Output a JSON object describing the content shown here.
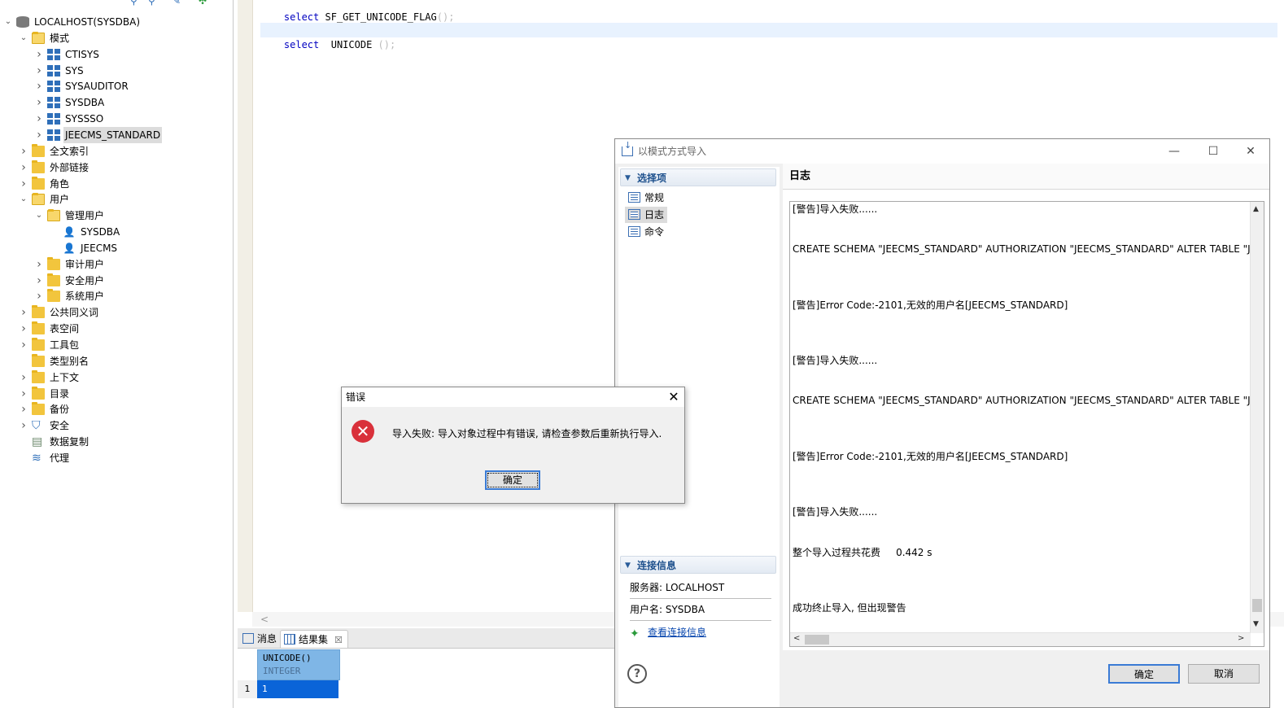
{
  "navigator": {
    "tree": [
      {
        "label": "LOCALHOST(SYSDBA)",
        "icon": "database-server-icon",
        "expanded": true,
        "indent": 0
      },
      {
        "label": "模式",
        "icon": "folder-open-icon",
        "expanded": true,
        "indent": 1
      },
      {
        "label": "CTISYS",
        "icon": "schema-icon",
        "expanded": false,
        "indent": 2
      },
      {
        "label": "SYS",
        "icon": "schema-icon",
        "expanded": false,
        "indent": 2
      },
      {
        "label": "SYSAUDITOR",
        "icon": "schema-icon",
        "expanded": false,
        "indent": 2
      },
      {
        "label": "SYSDBA",
        "icon": "schema-icon",
        "expanded": false,
        "indent": 2
      },
      {
        "label": "SYSSSO",
        "icon": "schema-icon",
        "expanded": false,
        "indent": 2
      },
      {
        "label": "JEECMS_STANDARD",
        "icon": "schema-icon",
        "expanded": false,
        "indent": 2,
        "selected": true
      },
      {
        "label": "全文索引",
        "icon": "folder-icon",
        "expanded": false,
        "indent": 1
      },
      {
        "label": "外部链接",
        "icon": "folder-icon",
        "expanded": false,
        "indent": 1
      },
      {
        "label": "角色",
        "icon": "folder-icon",
        "expanded": false,
        "indent": 1
      },
      {
        "label": "用户",
        "icon": "folder-open-icon",
        "expanded": true,
        "indent": 1
      },
      {
        "label": "管理用户",
        "icon": "folder-open-icon",
        "expanded": true,
        "indent": 2
      },
      {
        "label": "SYSDBA",
        "icon": "user-icon",
        "leaf": true,
        "indent": 3
      },
      {
        "label": "JEECMS",
        "icon": "user-icon",
        "leaf": true,
        "indent": 3
      },
      {
        "label": "审计用户",
        "icon": "folder-icon",
        "expanded": false,
        "indent": 2
      },
      {
        "label": "安全用户",
        "icon": "folder-icon",
        "expanded": false,
        "indent": 2
      },
      {
        "label": "系统用户",
        "icon": "folder-icon",
        "expanded": false,
        "indent": 2
      },
      {
        "label": "公共同义词",
        "icon": "folder-icon",
        "expanded": false,
        "indent": 1
      },
      {
        "label": "表空间",
        "icon": "folder-icon",
        "expanded": false,
        "indent": 1
      },
      {
        "label": "工具包",
        "icon": "folder-icon",
        "expanded": false,
        "indent": 1
      },
      {
        "label": "类型别名",
        "icon": "folder-icon",
        "leaf": true,
        "indent": 1
      },
      {
        "label": "上下文",
        "icon": "folder-icon",
        "expanded": false,
        "indent": 1
      },
      {
        "label": "目录",
        "icon": "folder-icon",
        "expanded": false,
        "indent": 1
      },
      {
        "label": "备份",
        "icon": "folder-icon",
        "expanded": false,
        "indent": 1
      },
      {
        "label": "安全",
        "icon": "shield-icon",
        "expanded": false,
        "indent": 1
      },
      {
        "label": "数据复制",
        "icon": "replication-icon",
        "leaf": true,
        "indent": 1
      },
      {
        "label": "代理",
        "icon": "agent-icon",
        "leaf": true,
        "indent": 1
      }
    ]
  },
  "editor": {
    "line1": {
      "keyword": "select",
      "rest": " SF_GET_UNICODE_FLAG",
      "paren": "();"
    },
    "line2": {
      "keyword": "select",
      "rest": "  UNICODE ",
      "paren": "();"
    },
    "hscroll_arrow": "<"
  },
  "results": {
    "tabs": [
      {
        "label": "消息",
        "icon": "message-icon"
      },
      {
        "label": "结果集",
        "icon": "grid-icon",
        "close": "☒"
      }
    ],
    "column": {
      "name": "UNICODE()",
      "type": "INTEGER"
    },
    "rows": [
      {
        "num": "1",
        "value": "1"
      }
    ]
  },
  "import_dialog": {
    "title": "以模式方式导入",
    "sections": {
      "options_header": "选择项",
      "options": [
        "常规",
        "日志",
        "命令"
      ],
      "selected_option": "日志",
      "conn_header": "连接信息",
      "server": "服务器: LOCALHOST",
      "user": "用户名: SYSDBA",
      "link": "查看连接信息"
    },
    "log_title": "日志",
    "log_lines": [
      "[警告]导入失败......",
      " CREATE SCHEMA \"JEECMS_STANDARD\" AUTHORIZATION  \"JEECMS_STANDARD\" ALTER TABLE \"JEECMS_STAND",
      "[警告]Error Code:-2101,无效的用户名[JEECMS_STANDARD]",
      "[警告]导入失败......",
      " CREATE SCHEMA \"JEECMS_STANDARD\" AUTHORIZATION  \"JEECMS_STANDARD\" ALTER TABLE \"JEECMS_STAND",
      "[警告]Error Code:-2101,无效的用户名[JEECMS_STANDARD]",
      "[警告]导入失败......",
      "整个导入过程共花费     0.442 s",
      "成功终止导入, 但出现警告"
    ],
    "ok_label": "确定",
    "cancel_label": "取消",
    "help_label": "?",
    "win_min": "—",
    "win_max": "☐",
    "win_close": "✕"
  },
  "error_dialog": {
    "title": "错误",
    "message": "导入失败: 导入对象过程中有错误, 请检查参数后重新执行导入.",
    "ok_label": "确定",
    "close": "✕",
    "icon_glyph": "✕"
  },
  "colors": {
    "selection_blue": "#0a64d8",
    "header_blue": "#7fb6e6",
    "error_red": "#d9313b",
    "link_blue": "#0645ad"
  }
}
